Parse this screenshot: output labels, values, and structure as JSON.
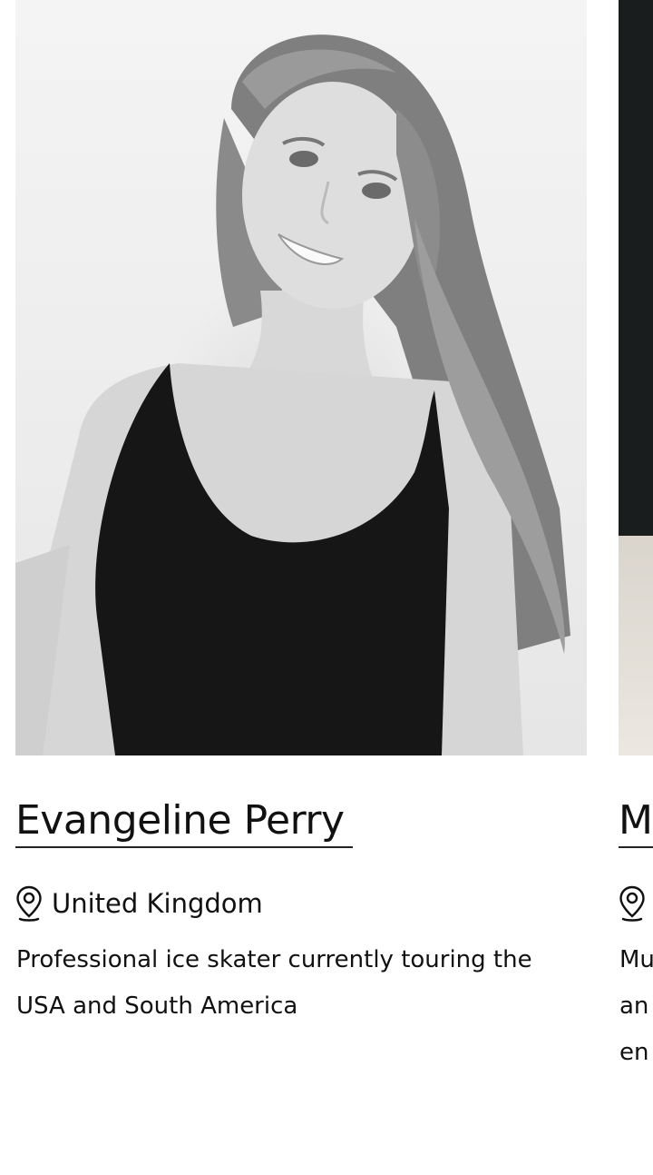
{
  "profiles": [
    {
      "name": "Evangeline Perry",
      "location_icon": "map-pin-icon",
      "location": "United Kingdom",
      "bio": "Professional ice skater currently touring the USA and South America"
    },
    {
      "name": "M",
      "location_icon": "map-pin-icon",
      "location": "",
      "bio_lines": [
        "Mu",
        "an",
        "en"
      ]
    }
  ],
  "colors": {
    "text": "#111111",
    "underline": "#222222",
    "background": "#ffffff"
  }
}
